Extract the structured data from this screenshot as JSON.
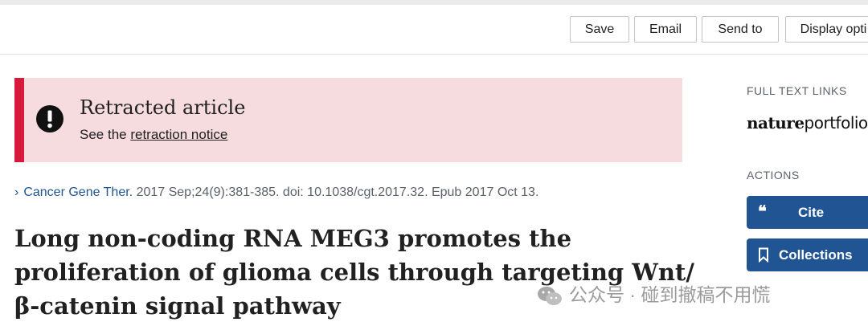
{
  "toolbar": {
    "save": "Save",
    "email": "Email",
    "send_to": "Send to",
    "display": "Display opti"
  },
  "retraction": {
    "title": "Retracted article",
    "prefix": "See the",
    "link": "retraction notice"
  },
  "citation": {
    "journal": "Cancer Gene Ther.",
    "details": "2017 Sep;24(9):381-385. doi: 10.1038/cgt.2017.32. Epub 2017 Oct 13."
  },
  "article": {
    "title_line1": "Long non-coding RNA MEG3 promotes the",
    "title_line2": "proliferation of glioma cells through targeting Wnt/",
    "title_line3": "β-catenin signal pathway"
  },
  "sidebar": {
    "full_text_heading": "FULL TEXT LINKS",
    "logo_bold": "nature",
    "logo_rest": "portfolio",
    "actions_heading": "ACTIONS",
    "cite_label": "Cite",
    "collections_label": "Collections"
  },
  "watermark": {
    "text": "公众号 · 碰到撤稿不用慌"
  },
  "colors": {
    "accent": "#205493",
    "retraction_bar": "#d7193b",
    "retraction_bg": "#f7dcdf"
  }
}
